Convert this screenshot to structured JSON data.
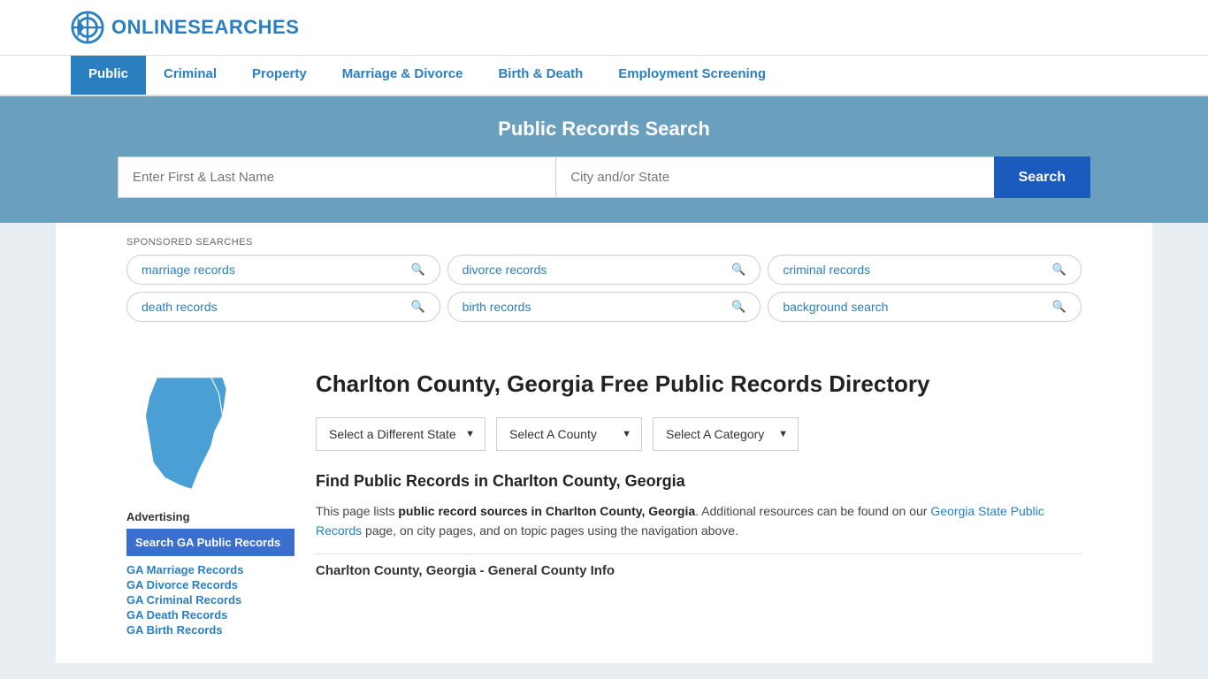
{
  "site": {
    "logo_text_plain": "ONLINE",
    "logo_text_colored": "SEARCHES",
    "title": "Public Records Search"
  },
  "nav": {
    "items": [
      {
        "label": "Public",
        "active": true
      },
      {
        "label": "Criminal",
        "active": false
      },
      {
        "label": "Property",
        "active": false
      },
      {
        "label": "Marriage & Divorce",
        "active": false
      },
      {
        "label": "Birth & Death",
        "active": false
      },
      {
        "label": "Employment Screening",
        "active": false
      }
    ]
  },
  "search": {
    "banner_title": "Public Records Search",
    "name_placeholder": "Enter First & Last Name",
    "city_placeholder": "City and/or State",
    "button_label": "Search"
  },
  "sponsored": {
    "label": "SPONSORED SEARCHES",
    "tags": [
      "marriage records",
      "divorce records",
      "criminal records",
      "death records",
      "birth records",
      "background search"
    ]
  },
  "sidebar": {
    "advertising_label": "Advertising",
    "ad_block_text": "Search GA Public Records",
    "links": [
      "GA Marriage Records",
      "GA Divorce Records",
      "GA Criminal Records",
      "GA Death Records",
      "GA Birth Records"
    ]
  },
  "page": {
    "title": "Charlton County, Georgia Free Public Records Directory",
    "dropdown_state": "Select a Different State",
    "dropdown_county": "Select A County",
    "dropdown_category": "Select A Category",
    "find_records_title": "Find Public Records in Charlton County, Georgia",
    "description": "This page lists ",
    "description_bold": "public record sources in Charlton County, Georgia",
    "description_mid": ". Additional resources can be found on our ",
    "description_link": "Georgia State Public Records",
    "description_end": " page, on city pages, and on topic pages using the navigation above.",
    "county_info_title": "Charlton County, Georgia - General County Info"
  }
}
